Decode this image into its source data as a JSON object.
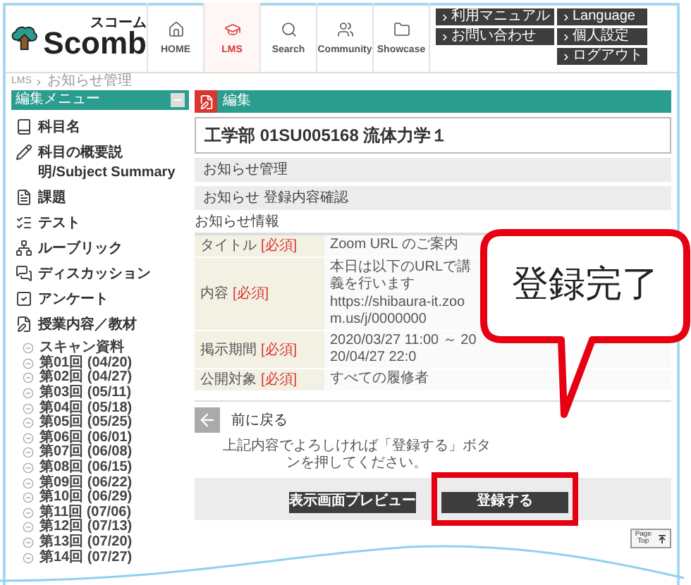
{
  "header": {
    "logo": {
      "name": "Scomb",
      "reading": "スコーム"
    },
    "nav": [
      {
        "label": "HOME",
        "selected": false
      },
      {
        "label": "LMS",
        "selected": true
      },
      {
        "label": "Search",
        "selected": false
      },
      {
        "label": "Community",
        "selected": false
      },
      {
        "label": "Showcase",
        "selected": false
      }
    ],
    "links": [
      "利用マニュアル",
      "Language",
      "お問い合わせ",
      "個人設定",
      "ログアウト"
    ]
  },
  "breadcrumb": [
    "LMS",
    "お知らせ管理"
  ],
  "sidebar": {
    "title": "編集メニュー",
    "expanded": true,
    "items": [
      "科目名",
      "科目の概要説明/Subject Summary",
      "課題",
      "テスト",
      "ルーブリック",
      "ディスカッション",
      "アンケート",
      "授業内容／教材"
    ],
    "materials": [
      "スキャン資料",
      "第01回 (04/20)",
      "第02回 (04/27)",
      "第03回 (05/11)",
      "第04回 (05/18)",
      "第05回 (05/25)",
      "第06回 (06/01)",
      "第07回 (06/08)",
      "第08回 (06/15)",
      "第09回 (06/22)",
      "第10回 (06/29)",
      "第11回 (07/06)",
      "第12回 (07/13)",
      "第13回 (07/20)",
      "第14回 (07/27)"
    ]
  },
  "main": {
    "section_title": "編集",
    "course_title": "工学部 01SU005168 流体力学１",
    "bars": [
      "お知らせ管理",
      "お知らせ 登録内容確認"
    ],
    "info_heading": "お知らせ情報",
    "fields": [
      {
        "label": "タイトル",
        "required": "[必須]",
        "values": [
          "Zoom URL のご案内"
        ]
      },
      {
        "label": "内容",
        "required": "[必須]",
        "values": [
          "本日は以下のURLで講義を行います",
          "https://shibaura-it.zoom.us/j/0000000"
        ]
      },
      {
        "label": "掲示期間",
        "required": "[必須]",
        "values": [
          "2020/03/27 11:00 ～ 2020/04/27 22:0"
        ]
      },
      {
        "label": "公開対象",
        "required": "[必須]",
        "values": [
          "すべての履修者"
        ]
      }
    ],
    "back": "前に戻る",
    "notice": "上記内容でよろしければ「登録する」ボタンを押してください。",
    "buttons": [
      {
        "label": "表示画面プレビュー",
        "highlighted": false
      },
      {
        "label": "登録する",
        "highlighted": true
      }
    ],
    "page_top": [
      "Page",
      "Top"
    ]
  },
  "callout": {
    "text": "登録完了"
  }
}
